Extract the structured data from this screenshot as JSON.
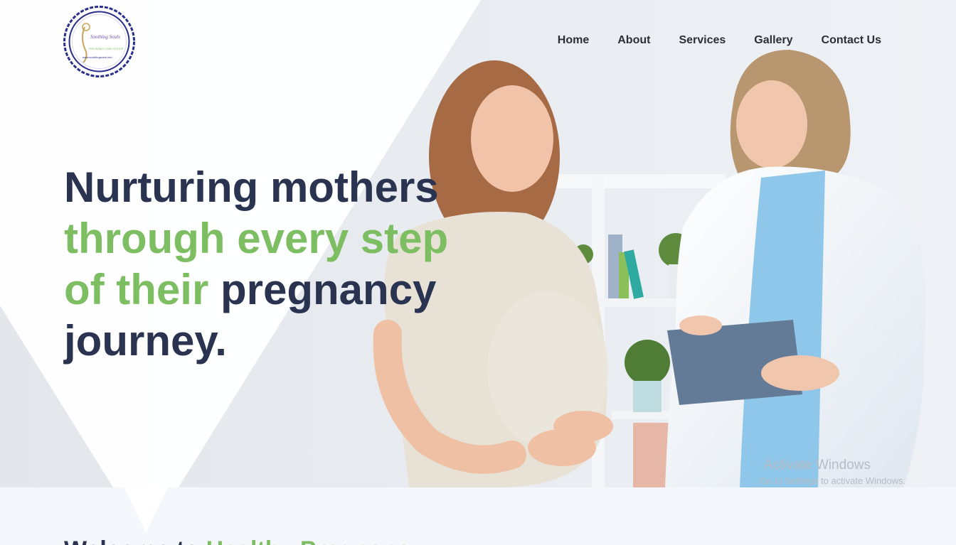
{
  "brand": {
    "logo_alt": "Soothing Souls",
    "logo_name": "Soothing Souls",
    "logo_tagline": "PREGNANCY CARE CENTER",
    "logo_url": "www.soothingsouls.info"
  },
  "nav": {
    "items": [
      {
        "label": "Home"
      },
      {
        "label": "About"
      },
      {
        "label": "Services"
      },
      {
        "label": "Gallery"
      },
      {
        "label": "Contact Us"
      }
    ]
  },
  "hero": {
    "line1": "Nurturing mothers",
    "line2": "through every step",
    "line3_green": "of their",
    "line3_dark": "pregnancy",
    "line4": "journey."
  },
  "watermark": {
    "title": "Activate Windows",
    "subtitle": "Go to Settings to activate Windows."
  },
  "welcome": {
    "prefix": "Welcome to",
    "highlight": "Healthy Pregnancy"
  },
  "colors": {
    "dark": "#2a3350",
    "green": "#7ebe63",
    "nav": "#2b2f3a",
    "band": "#f4f7fb"
  }
}
